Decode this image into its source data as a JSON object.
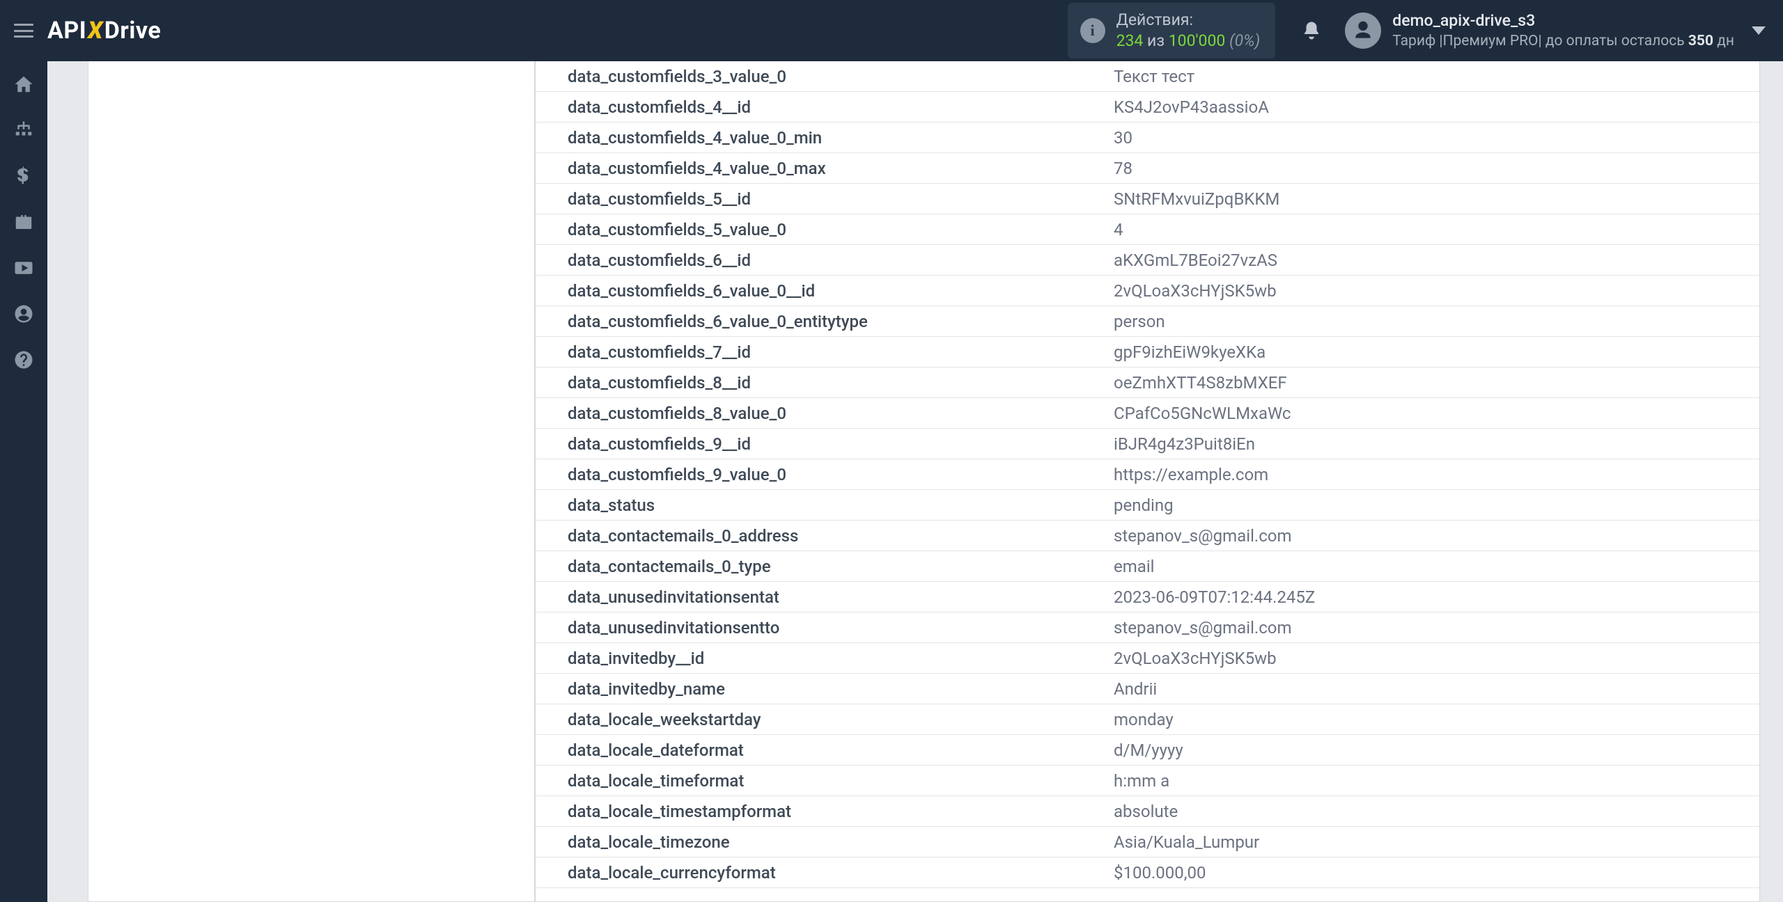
{
  "header": {
    "logo": {
      "api": "API",
      "x": "X",
      "drive": "Drive"
    },
    "actions": {
      "label": "Действия:",
      "used": "234",
      "of_word": " из ",
      "total": "100'000",
      "pct": " (0%)"
    },
    "user": {
      "name": "demo_apix-drive_s3",
      "tariff_prefix": "Тариф |",
      "tariff_name": "Премиум PRO",
      "tariff_mid": "| до оплаты осталось ",
      "days": "350",
      "days_suffix": " дн"
    }
  },
  "rows": [
    {
      "k": "data_customfields_3_value_0",
      "v": "Текст тест"
    },
    {
      "k": "data_customfields_4__id",
      "v": "KS4J2ovP43aassioA"
    },
    {
      "k": "data_customfields_4_value_0_min",
      "v": "30"
    },
    {
      "k": "data_customfields_4_value_0_max",
      "v": "78"
    },
    {
      "k": "data_customfields_5__id",
      "v": "SNtRFMxvuiZpqBKKM"
    },
    {
      "k": "data_customfields_5_value_0",
      "v": "4"
    },
    {
      "k": "data_customfields_6__id",
      "v": "aKXGmL7BEoi27vzAS"
    },
    {
      "k": "data_customfields_6_value_0__id",
      "v": "2vQLoaX3cHYjSK5wb"
    },
    {
      "k": "data_customfields_6_value_0_entitytype",
      "v": "person"
    },
    {
      "k": "data_customfields_7__id",
      "v": "gpF9izhEiW9kyeXKa"
    },
    {
      "k": "data_customfields_8__id",
      "v": "oeZmhXTT4S8zbMXEF"
    },
    {
      "k": "data_customfields_8_value_0",
      "v": "CPafCo5GNcWLMxaWc"
    },
    {
      "k": "data_customfields_9__id",
      "v": "iBJR4g4z3Puit8iEn"
    },
    {
      "k": "data_customfields_9_value_0",
      "v": "https://example.com"
    },
    {
      "k": "data_status",
      "v": "pending"
    },
    {
      "k": "data_contactemails_0_address",
      "v": "stepanov_s@gmail.com"
    },
    {
      "k": "data_contactemails_0_type",
      "v": "email"
    },
    {
      "k": "data_unusedinvitationsentat",
      "v": "2023-06-09T07:12:44.245Z"
    },
    {
      "k": "data_unusedinvitationsentto",
      "v": "stepanov_s@gmail.com"
    },
    {
      "k": "data_invitedby__id",
      "v": "2vQLoaX3cHYjSK5wb"
    },
    {
      "k": "data_invitedby_name",
      "v": "Andrii"
    },
    {
      "k": "data_locale_weekstartday",
      "v": "monday"
    },
    {
      "k": "data_locale_dateformat",
      "v": "d/M/yyyy"
    },
    {
      "k": "data_locale_timeformat",
      "v": "h:mm a"
    },
    {
      "k": "data_locale_timestampformat",
      "v": "absolute"
    },
    {
      "k": "data_locale_timezone",
      "v": "Asia/Kuala_Lumpur"
    },
    {
      "k": "data_locale_currencyformat",
      "v": "$100.000,00"
    }
  ]
}
